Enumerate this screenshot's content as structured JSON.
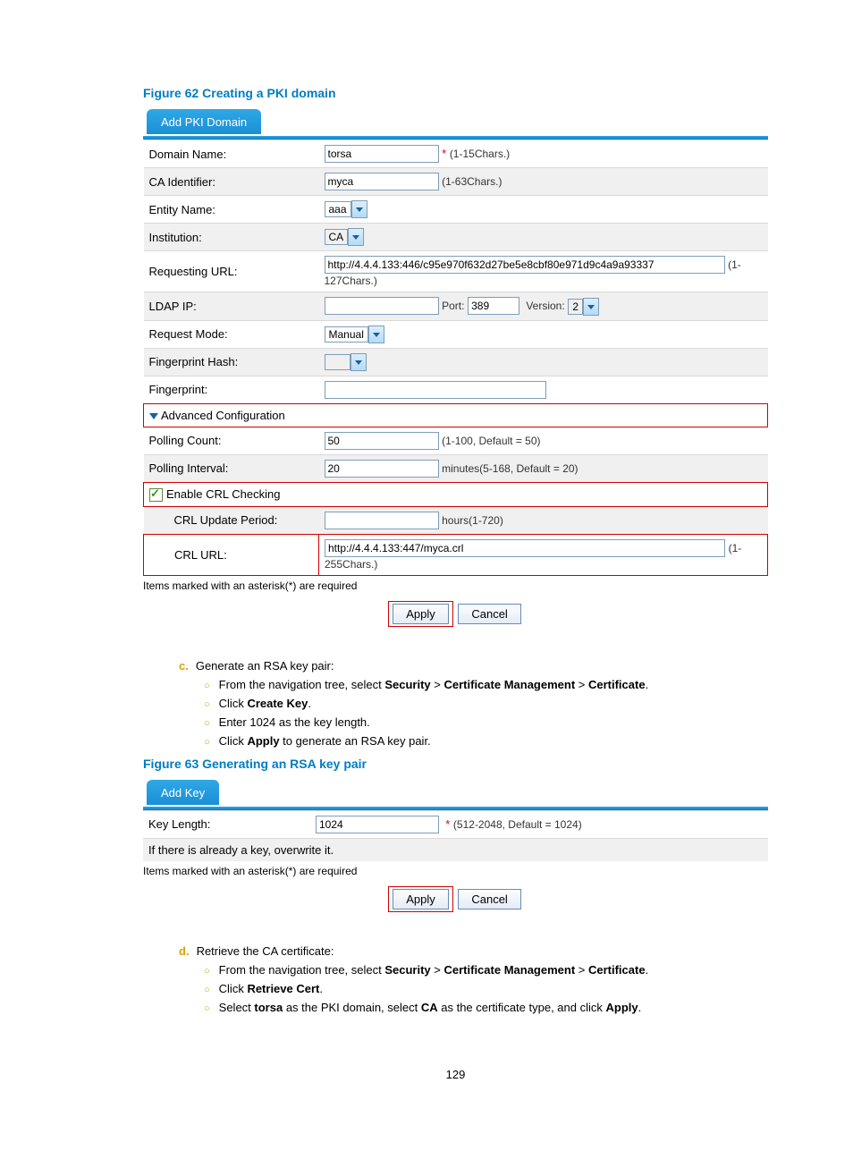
{
  "figure62": {
    "caption": "Figure 62 Creating a PKI domain",
    "tab": "Add PKI Domain",
    "rows": {
      "domainName": {
        "label": "Domain Name:",
        "value": "torsa",
        "hint": "(1-15Chars.)",
        "req": "*"
      },
      "caIdentifier": {
        "label": "CA Identifier:",
        "value": "myca",
        "hint": "(1-63Chars.)"
      },
      "entityName": {
        "label": "Entity Name:",
        "value": "aaa"
      },
      "institution": {
        "label": "Institution:",
        "value": "CA"
      },
      "requestingUrl": {
        "label": "Requesting URL:",
        "value": "http://4.4.4.133:446/c95e970f632d27be5e8cbf80e971d9c4a9a93337",
        "hint": "(1-127Chars.)"
      },
      "ldapIp": {
        "label": "LDAP IP:",
        "portLabel": "Port:",
        "portValue": "389",
        "versionLabel": "Version:",
        "versionValue": "2"
      },
      "requestMode": {
        "label": "Request Mode:",
        "value": "Manual"
      },
      "fingerprintHash": {
        "label": "Fingerprint Hash:"
      },
      "fingerprint": {
        "label": "Fingerprint:"
      },
      "advanced": {
        "label": "Advanced Configuration"
      },
      "pollingCount": {
        "label": "Polling Count:",
        "value": "50",
        "hint": "(1-100, Default = 50)"
      },
      "pollingInterval": {
        "label": "Polling Interval:",
        "value": "20",
        "hint": "minutes(5-168, Default = 20)"
      },
      "enableCrl": {
        "label": "Enable CRL Checking"
      },
      "crlUpdate": {
        "label": "CRL Update Period:",
        "hint": "hours(1-720)"
      },
      "crlUrl": {
        "label": "CRL URL:",
        "value": "http://4.4.4.133:447/myca.crl",
        "hint": "(1-255Chars.)"
      }
    },
    "requiredNote": "Items marked with an asterisk(*) are required",
    "apply": "Apply",
    "cancel": "Cancel"
  },
  "stepC": {
    "marker": "c.",
    "text": "Generate an RSA key pair:",
    "subs": {
      "s1a": "From the navigation tree, select ",
      "s1b": "Security",
      "gt": " > ",
      "s1c": "Certificate Management",
      "s1d": "Certificate",
      "s1e": ".",
      "s2a": "Click ",
      "s2b": "Create Key",
      "s2c": ".",
      "s3": "Enter 1024 as the key length.",
      "s4a": "Click ",
      "s4b": "Apply",
      "s4c": " to generate an RSA key pair."
    }
  },
  "figure63": {
    "caption": "Figure 63 Generating an RSA key pair",
    "tab": "Add Key",
    "keyLengthLabel": "Key Length:",
    "keyLengthValue": "1024",
    "keyLengthHint": "(512-2048, Default = 1024)",
    "keyLengthReq": "*",
    "overwrite": "If there is already a key, overwrite it.",
    "requiredNote": "Items marked with an asterisk(*) are required",
    "apply": "Apply",
    "cancel": "Cancel"
  },
  "stepD": {
    "marker": "d.",
    "text": "Retrieve the CA certificate:",
    "subs": {
      "s1a": "From the navigation tree, select ",
      "s1b": "Security",
      "gt": " > ",
      "s1c": "Certificate Management",
      "s1d": "Certificate",
      "s1e": ".",
      "s2a": "Click ",
      "s2b": "Retrieve Cert",
      "s2c": ".",
      "s3a": "Select ",
      "s3b": "torsa",
      "s3c": " as the PKI domain, select ",
      "s3d": "CA",
      "s3e": " as the certificate type, and click ",
      "s3f": "Apply",
      "s3g": "."
    }
  },
  "pageNumber": "129"
}
